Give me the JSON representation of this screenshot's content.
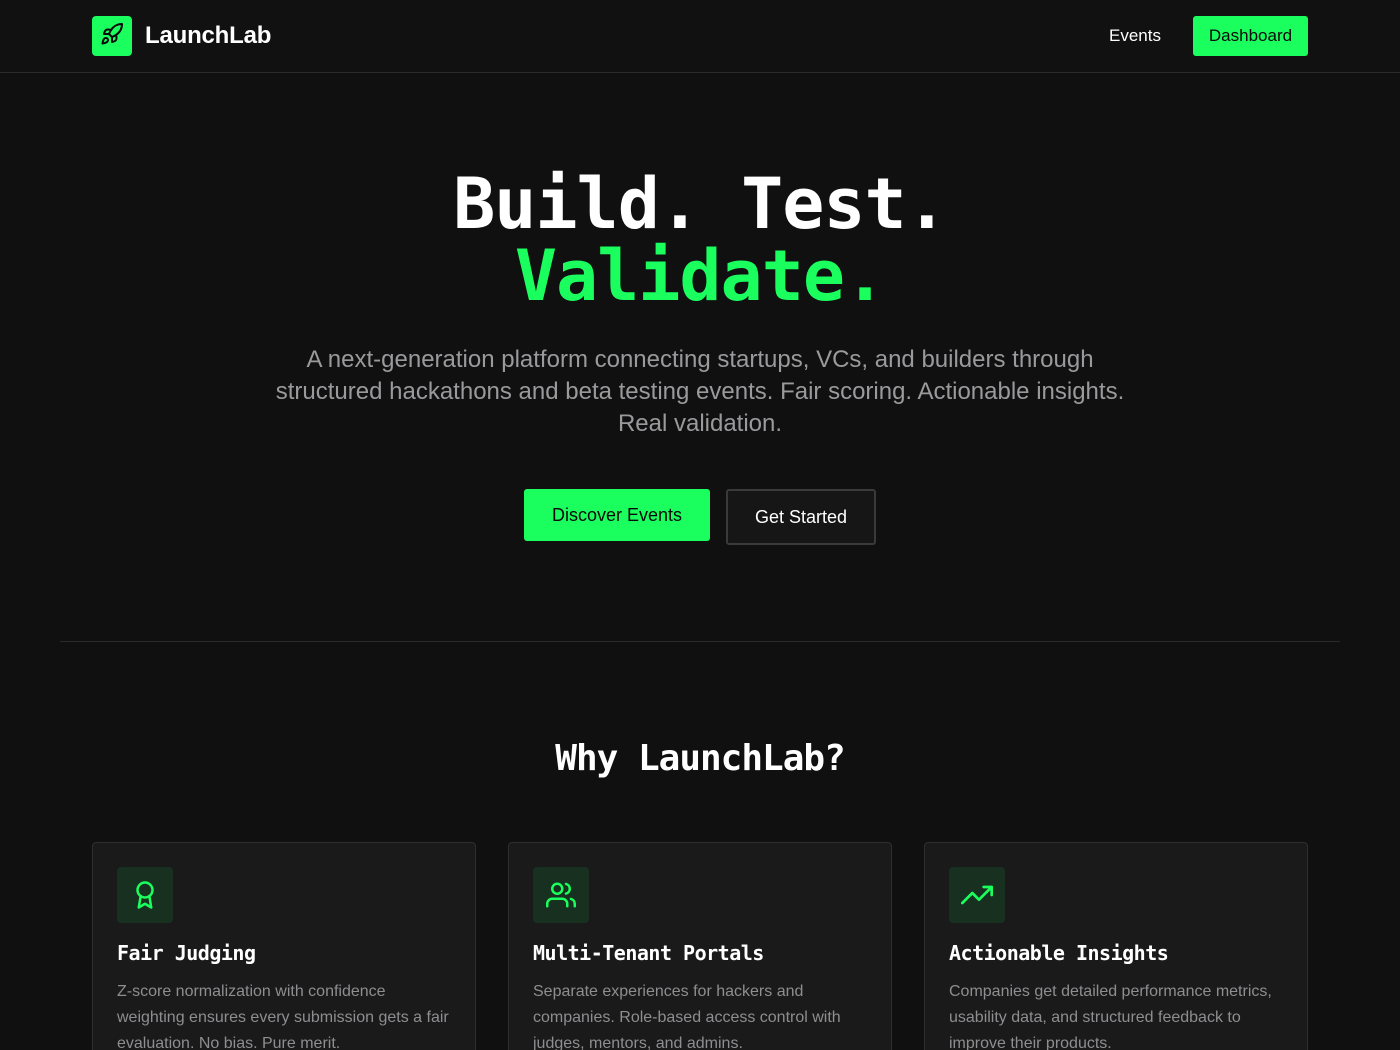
{
  "colors": {
    "accent": "#1aff5e",
    "background": "#101011",
    "card": "#1a1a1b",
    "muted": "#9a9a9c"
  },
  "nav": {
    "brand": "LaunchLab",
    "logo_icon": "rocket-icon",
    "links": [
      {
        "label": "Events"
      }
    ],
    "dashboard_label": "Dashboard"
  },
  "hero": {
    "title_line1": "Build. Test.",
    "title_line2": "Validate.",
    "subtitle": "A next-generation platform connecting startups, VCs, and builders through structured hackathons and beta testing events. Fair scoring. Actionable insights. Real validation.",
    "primary_cta": "Discover Events",
    "secondary_cta": "Get Started"
  },
  "features": {
    "title": "Why LaunchLab?",
    "cards": [
      {
        "icon": "award-icon",
        "title": "Fair Judging",
        "text": "Z-score normalization with confidence weighting ensures every submission gets a fair evaluation. No bias. Pure merit."
      },
      {
        "icon": "users-icon",
        "title": "Multi-Tenant Portals",
        "text": "Separate experiences for hackers and companies. Role-based access control with judges, mentors, and admins."
      },
      {
        "icon": "trending-up-icon",
        "title": "Actionable Insights",
        "text": "Companies get detailed performance metrics, usability data, and structured feedback to improve their products."
      }
    ]
  }
}
